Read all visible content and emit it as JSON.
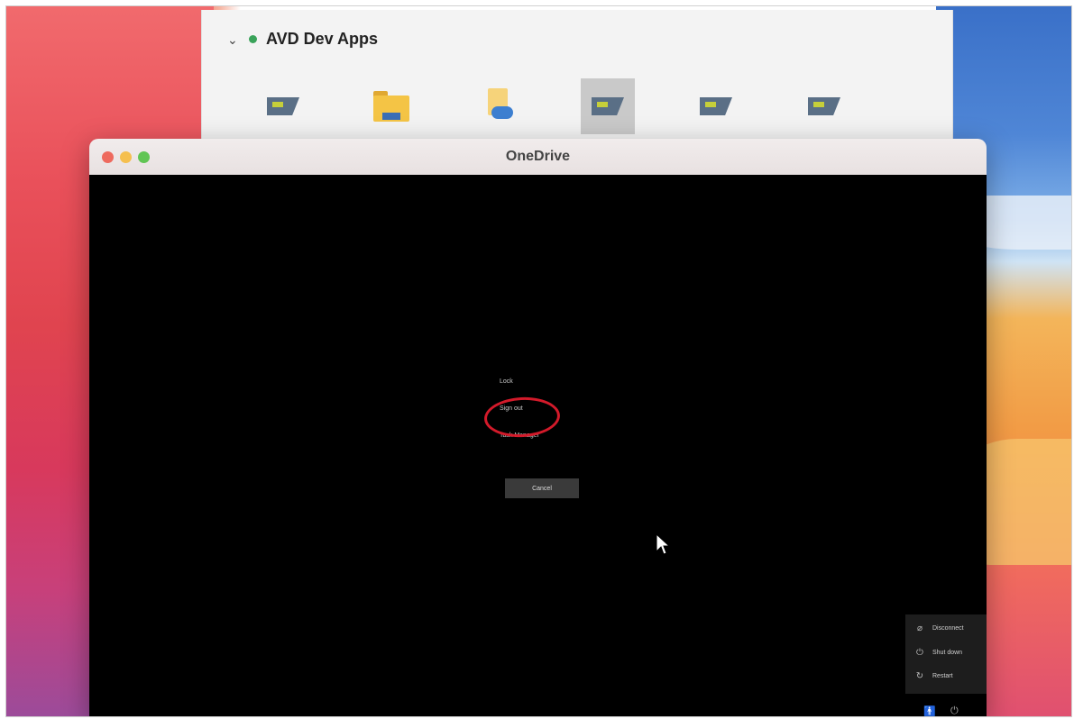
{
  "workspace": {
    "title": "AVD Dev Apps",
    "status_color": "#3aa35a",
    "apps": [
      {
        "icon": "remote-desktop-icon"
      },
      {
        "icon": "folder-icon"
      },
      {
        "icon": "onedrive-document-icon"
      },
      {
        "icon": "remote-desktop-icon",
        "selected": true
      },
      {
        "icon": "remote-desktop-icon"
      },
      {
        "icon": "remote-desktop-icon"
      }
    ]
  },
  "window": {
    "title": "OneDrive"
  },
  "security_menu": {
    "lock": "Lock",
    "sign_out": "Sign out",
    "task_manager": "Task Manager",
    "cancel": "Cancel"
  },
  "power_menu": {
    "disconnect": "Disconnect",
    "shut_down": "Shut down",
    "restart": "Restart"
  },
  "colors": {
    "highlight": "#d31a2a"
  }
}
